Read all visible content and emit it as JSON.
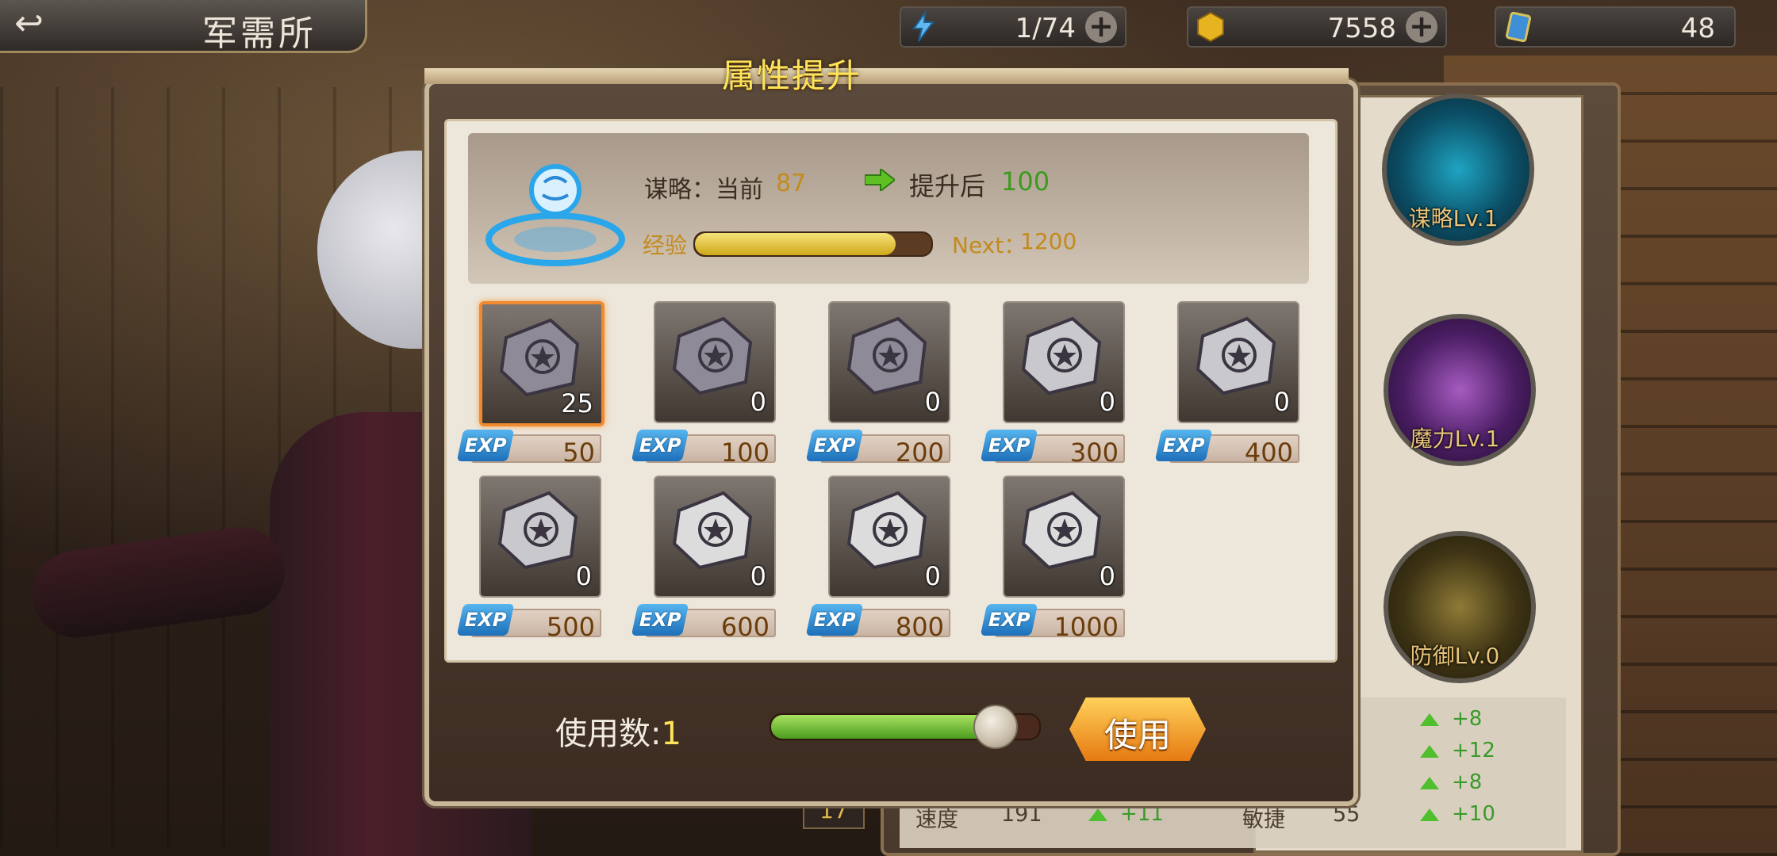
{
  "topbar": {
    "back_glyph": "↩",
    "title": "军需所",
    "energy": "1/74",
    "gold": "7558",
    "gems": "48",
    "plus": "+"
  },
  "dialog": {
    "title": "属性提升",
    "current_label": "谋略：当前",
    "current_value": "87",
    "after_label": "提升后",
    "after_value": "100",
    "exp_label": "经验",
    "exp_progress": 0.85,
    "next_label": "Next：",
    "next_value": "1200",
    "items": [
      {
        "count": "25",
        "exp": "50",
        "selected": true
      },
      {
        "count": "0",
        "exp": "100"
      },
      {
        "count": "0",
        "exp": "200"
      },
      {
        "count": "0",
        "exp": "300"
      },
      {
        "count": "0",
        "exp": "400"
      },
      {
        "count": "0",
        "exp": "500"
      },
      {
        "count": "0",
        "exp": "600"
      },
      {
        "count": "0",
        "exp": "800"
      },
      {
        "count": "0",
        "exp": "1000"
      }
    ],
    "exp_badge": "EXP",
    "use_count_label": "使用数:",
    "use_count_value": "1",
    "slider_level": 0.83,
    "use_button": "使用"
  },
  "right_panel": {
    "orbs": [
      {
        "label": "谋略Lv.1"
      },
      {
        "label": "魔力Lv.1"
      },
      {
        "label": "防御Lv.0"
      }
    ],
    "stats": [
      {
        "name": "速度",
        "value": "191",
        "bonus": "+11"
      },
      {
        "name": "敏捷",
        "value": "55",
        "bonus": "+10"
      }
    ],
    "bonuses": [
      "+8",
      "+12",
      "+8"
    ],
    "badge": "17"
  },
  "colors": {
    "accent_gold": "#ffe45a",
    "exp_blue": "#1d6fb9",
    "selected_border": "#f08a30",
    "green": "#3c9a1e"
  }
}
